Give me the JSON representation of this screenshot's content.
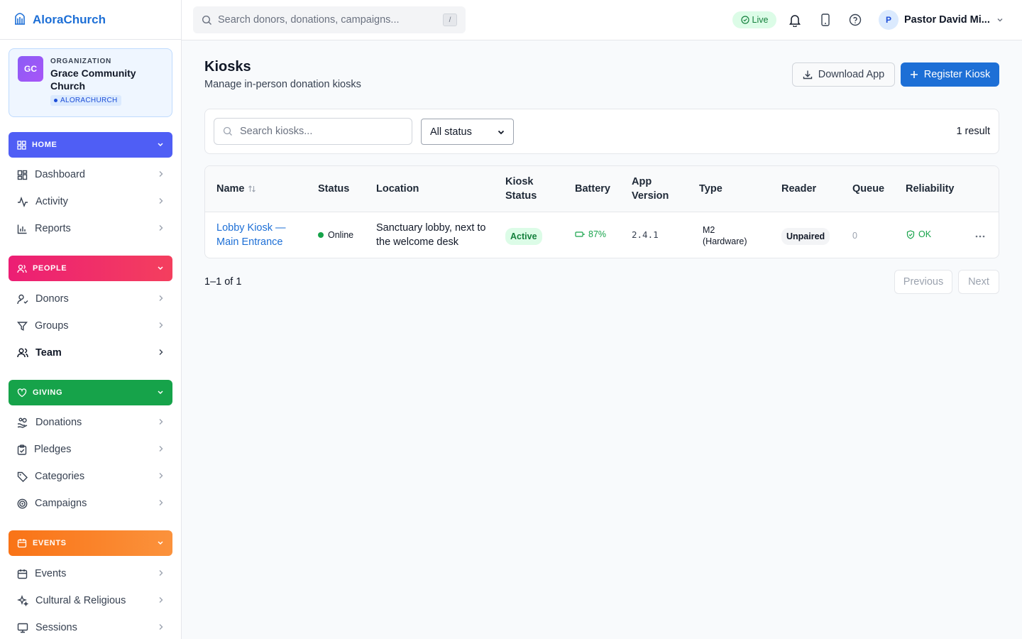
{
  "brand": {
    "name": "AloraChurch"
  },
  "org": {
    "initials": "GC",
    "label": "ORGANIZATION",
    "name": "Grace Community Church",
    "tag": "ALORACHURCH"
  },
  "sidebar": {
    "sections": [
      {
        "title": "HOME",
        "color": "#4f5ef5",
        "items": [
          "Dashboard",
          "Activity",
          "Reports"
        ]
      },
      {
        "title": "PEOPLE",
        "color": "#ec1e74",
        "items": [
          "Donors",
          "Groups",
          "Team"
        ]
      },
      {
        "title": "GIVING",
        "color": "#16a34a",
        "items": [
          "Donations",
          "Pledges",
          "Categories",
          "Campaigns"
        ]
      },
      {
        "title": "EVENTS",
        "color": "#f97316",
        "items": [
          "Events",
          "Cultural & Religious",
          "Sessions"
        ]
      }
    ],
    "active_item": "Team"
  },
  "topbar": {
    "search_placeholder": "Search donors, donations, campaigns...",
    "search_shortcut": "/",
    "live_label": "Live",
    "user_initial": "P",
    "user_name": "Pastor David Mi..."
  },
  "page": {
    "title": "Kiosks",
    "subtitle": "Manage in-person donation kiosks",
    "download_label": "Download App",
    "register_label": "Register Kiosk"
  },
  "filters": {
    "search_placeholder": "Search kiosks...",
    "status_value": "All status",
    "result_count": "1 result"
  },
  "table": {
    "headers": {
      "name": "Name",
      "status": "Status",
      "location": "Location",
      "kiosk_status": "Kiosk Status",
      "battery": "Battery",
      "app_version": "App Version",
      "type": "Type",
      "reader": "Reader",
      "queue": "Queue",
      "reliability": "Reliability"
    },
    "rows": [
      {
        "name": "Lobby Kiosk — Main Entrance",
        "status": "Online",
        "location": "Sanctuary lobby, next to the welcome desk",
        "kiosk_status": "Active",
        "battery": "87%",
        "app_version": "2.4.1",
        "type": "M2 (Hardware)",
        "reader": "Unpaired",
        "queue": "0",
        "reliability": "OK"
      }
    ]
  },
  "pagination": {
    "summary": "1–1 of 1",
    "previous_label": "Previous",
    "next_label": "Next"
  },
  "colors": {
    "primary": "#1d6fd6",
    "online": "#16a34a",
    "active_bg": "#dcfce7"
  }
}
